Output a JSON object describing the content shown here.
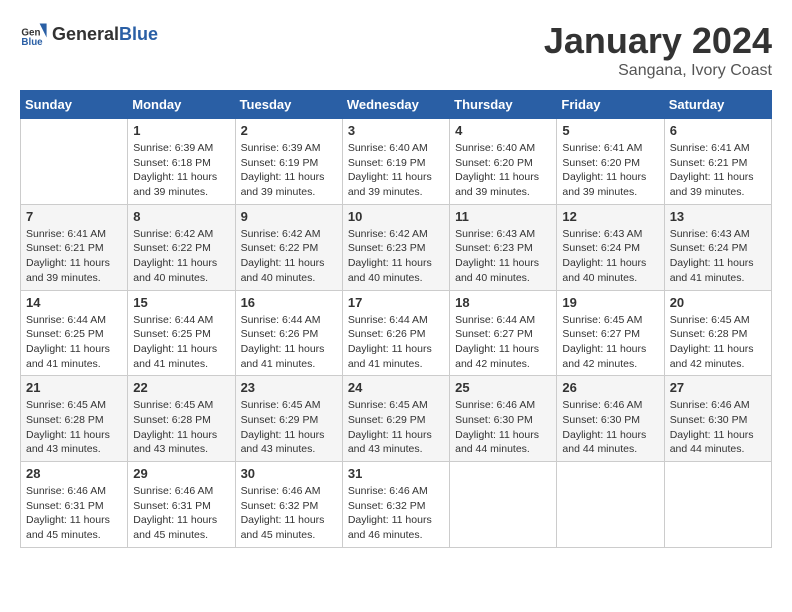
{
  "header": {
    "logo_general": "General",
    "logo_blue": "Blue",
    "title": "January 2024",
    "location": "Sangana, Ivory Coast"
  },
  "days_of_week": [
    "Sunday",
    "Monday",
    "Tuesday",
    "Wednesday",
    "Thursday",
    "Friday",
    "Saturday"
  ],
  "weeks": [
    [
      {
        "day": "",
        "empty": true
      },
      {
        "day": "1",
        "sunrise": "Sunrise: 6:39 AM",
        "sunset": "Sunset: 6:18 PM",
        "daylight": "Daylight: 11 hours and 39 minutes."
      },
      {
        "day": "2",
        "sunrise": "Sunrise: 6:39 AM",
        "sunset": "Sunset: 6:19 PM",
        "daylight": "Daylight: 11 hours and 39 minutes."
      },
      {
        "day": "3",
        "sunrise": "Sunrise: 6:40 AM",
        "sunset": "Sunset: 6:19 PM",
        "daylight": "Daylight: 11 hours and 39 minutes."
      },
      {
        "day": "4",
        "sunrise": "Sunrise: 6:40 AM",
        "sunset": "Sunset: 6:20 PM",
        "daylight": "Daylight: 11 hours and 39 minutes."
      },
      {
        "day": "5",
        "sunrise": "Sunrise: 6:41 AM",
        "sunset": "Sunset: 6:20 PM",
        "daylight": "Daylight: 11 hours and 39 minutes."
      },
      {
        "day": "6",
        "sunrise": "Sunrise: 6:41 AM",
        "sunset": "Sunset: 6:21 PM",
        "daylight": "Daylight: 11 hours and 39 minutes."
      }
    ],
    [
      {
        "day": "7",
        "sunrise": "Sunrise: 6:41 AM",
        "sunset": "Sunset: 6:21 PM",
        "daylight": "Daylight: 11 hours and 39 minutes."
      },
      {
        "day": "8",
        "sunrise": "Sunrise: 6:42 AM",
        "sunset": "Sunset: 6:22 PM",
        "daylight": "Daylight: 11 hours and 40 minutes."
      },
      {
        "day": "9",
        "sunrise": "Sunrise: 6:42 AM",
        "sunset": "Sunset: 6:22 PM",
        "daylight": "Daylight: 11 hours and 40 minutes."
      },
      {
        "day": "10",
        "sunrise": "Sunrise: 6:42 AM",
        "sunset": "Sunset: 6:23 PM",
        "daylight": "Daylight: 11 hours and 40 minutes."
      },
      {
        "day": "11",
        "sunrise": "Sunrise: 6:43 AM",
        "sunset": "Sunset: 6:23 PM",
        "daylight": "Daylight: 11 hours and 40 minutes."
      },
      {
        "day": "12",
        "sunrise": "Sunrise: 6:43 AM",
        "sunset": "Sunset: 6:24 PM",
        "daylight": "Daylight: 11 hours and 40 minutes."
      },
      {
        "day": "13",
        "sunrise": "Sunrise: 6:43 AM",
        "sunset": "Sunset: 6:24 PM",
        "daylight": "Daylight: 11 hours and 41 minutes."
      }
    ],
    [
      {
        "day": "14",
        "sunrise": "Sunrise: 6:44 AM",
        "sunset": "Sunset: 6:25 PM",
        "daylight": "Daylight: 11 hours and 41 minutes."
      },
      {
        "day": "15",
        "sunrise": "Sunrise: 6:44 AM",
        "sunset": "Sunset: 6:25 PM",
        "daylight": "Daylight: 11 hours and 41 minutes."
      },
      {
        "day": "16",
        "sunrise": "Sunrise: 6:44 AM",
        "sunset": "Sunset: 6:26 PM",
        "daylight": "Daylight: 11 hours and 41 minutes."
      },
      {
        "day": "17",
        "sunrise": "Sunrise: 6:44 AM",
        "sunset": "Sunset: 6:26 PM",
        "daylight": "Daylight: 11 hours and 41 minutes."
      },
      {
        "day": "18",
        "sunrise": "Sunrise: 6:44 AM",
        "sunset": "Sunset: 6:27 PM",
        "daylight": "Daylight: 11 hours and 42 minutes."
      },
      {
        "day": "19",
        "sunrise": "Sunrise: 6:45 AM",
        "sunset": "Sunset: 6:27 PM",
        "daylight": "Daylight: 11 hours and 42 minutes."
      },
      {
        "day": "20",
        "sunrise": "Sunrise: 6:45 AM",
        "sunset": "Sunset: 6:28 PM",
        "daylight": "Daylight: 11 hours and 42 minutes."
      }
    ],
    [
      {
        "day": "21",
        "sunrise": "Sunrise: 6:45 AM",
        "sunset": "Sunset: 6:28 PM",
        "daylight": "Daylight: 11 hours and 43 minutes."
      },
      {
        "day": "22",
        "sunrise": "Sunrise: 6:45 AM",
        "sunset": "Sunset: 6:28 PM",
        "daylight": "Daylight: 11 hours and 43 minutes."
      },
      {
        "day": "23",
        "sunrise": "Sunrise: 6:45 AM",
        "sunset": "Sunset: 6:29 PM",
        "daylight": "Daylight: 11 hours and 43 minutes."
      },
      {
        "day": "24",
        "sunrise": "Sunrise: 6:45 AM",
        "sunset": "Sunset: 6:29 PM",
        "daylight": "Daylight: 11 hours and 43 minutes."
      },
      {
        "day": "25",
        "sunrise": "Sunrise: 6:46 AM",
        "sunset": "Sunset: 6:30 PM",
        "daylight": "Daylight: 11 hours and 44 minutes."
      },
      {
        "day": "26",
        "sunrise": "Sunrise: 6:46 AM",
        "sunset": "Sunset: 6:30 PM",
        "daylight": "Daylight: 11 hours and 44 minutes."
      },
      {
        "day": "27",
        "sunrise": "Sunrise: 6:46 AM",
        "sunset": "Sunset: 6:30 PM",
        "daylight": "Daylight: 11 hours and 44 minutes."
      }
    ],
    [
      {
        "day": "28",
        "sunrise": "Sunrise: 6:46 AM",
        "sunset": "Sunset: 6:31 PM",
        "daylight": "Daylight: 11 hours and 45 minutes."
      },
      {
        "day": "29",
        "sunrise": "Sunrise: 6:46 AM",
        "sunset": "Sunset: 6:31 PM",
        "daylight": "Daylight: 11 hours and 45 minutes."
      },
      {
        "day": "30",
        "sunrise": "Sunrise: 6:46 AM",
        "sunset": "Sunset: 6:32 PM",
        "daylight": "Daylight: 11 hours and 45 minutes."
      },
      {
        "day": "31",
        "sunrise": "Sunrise: 6:46 AM",
        "sunset": "Sunset: 6:32 PM",
        "daylight": "Daylight: 11 hours and 46 minutes."
      },
      {
        "day": "",
        "empty": true
      },
      {
        "day": "",
        "empty": true
      },
      {
        "day": "",
        "empty": true
      }
    ]
  ]
}
